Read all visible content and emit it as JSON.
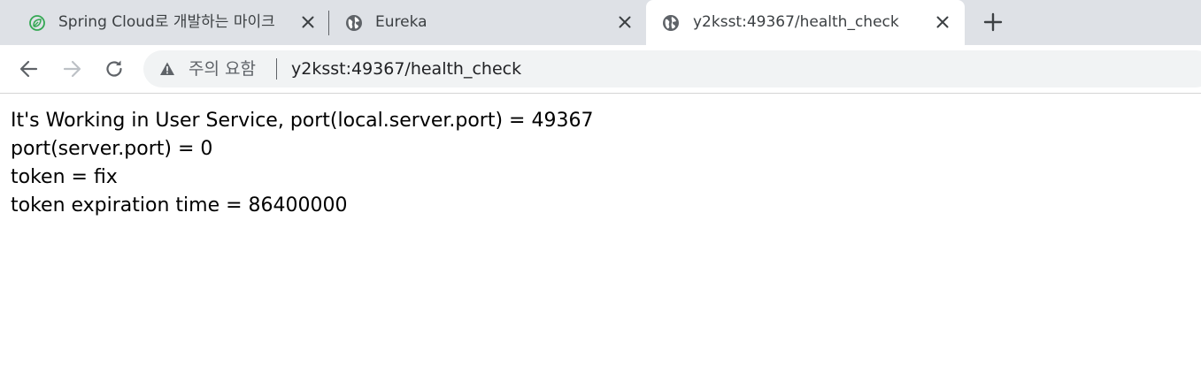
{
  "tabs": [
    {
      "title": "Spring Cloud로 개발하는 마이크",
      "favicon": "spring-leaf-icon",
      "active": false
    },
    {
      "title": "Eureka",
      "favicon": "globe-icon",
      "active": false
    },
    {
      "title": "y2ksst:49367/health_check",
      "favicon": "globe-icon",
      "active": true
    }
  ],
  "toolbar": {
    "security_label": "주의 요함",
    "url": "y2ksst:49367/health_check"
  },
  "page": {
    "lines": [
      "It's Working in User Service, port(local.server.port) = 49367",
      "port(server.port) = 0",
      "token = fix",
      "token expiration time = 86400000"
    ]
  },
  "colors": {
    "tabstrip": "#dee1e6",
    "spring_green": "#34a853",
    "icon_gray": "#5f6368",
    "omnibox": "#f1f3f4"
  }
}
